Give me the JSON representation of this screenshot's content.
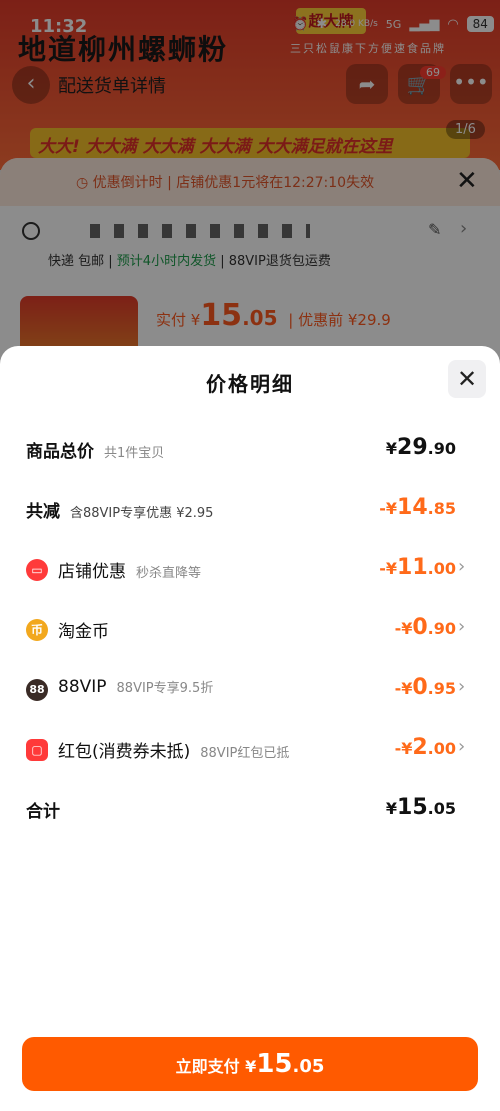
{
  "status_bar": {
    "time": "11:32",
    "network_speed": "28.0 KB/s",
    "network_type": "5G",
    "battery": "84"
  },
  "background_page": {
    "banner_title": "地道柳州螺蛳粉",
    "banner_strip": "大大! 大大满 大大满 大大满 大大满足就在这里",
    "page_counter": "1/6",
    "brand_logo": "超大牌",
    "brand_slogan": "三只松鼠康下方便速食品牌",
    "search_text": "配送货单详情",
    "cart_count": "69",
    "countdown_text": "优惠倒计时 | 店铺优惠1元将在12:27:10失效",
    "shipping_text_1": "快递 包邮",
    "shipping_text_2": "预计4小时内发货",
    "shipping_text_3": "88VIP退货包运费",
    "paid_label": "实付 ¥",
    "paid_int": "15",
    "paid_dec": ".05",
    "before_label": "| 优惠前 ¥29.9"
  },
  "modal": {
    "title": "价格明细",
    "rows": [
      {
        "label": "商品总价",
        "sub": "共1件宝贝",
        "currency": "¥",
        "int": "29",
        "dec": ".90"
      },
      {
        "label": "共减",
        "sub": "含88VIP专享优惠 ¥2.95",
        "currency": "-¥",
        "int": "14",
        "dec": ".85"
      },
      {
        "label": "店铺优惠",
        "sub": "秒杀直降等",
        "currency": "-¥",
        "int": "11",
        "dec": ".00",
        "icon": "store-coupon-icon"
      },
      {
        "label": "淘金币",
        "sub": "",
        "currency": "-¥",
        "int": "0",
        "dec": ".90",
        "icon": "gold-coin-icon",
        "icon_glyph": "币"
      },
      {
        "label": "88VIP",
        "sub": "88VIP专享9.5折",
        "currency": "-¥",
        "int": "0",
        "dec": ".95",
        "icon": "88vip-icon",
        "icon_glyph": "88"
      },
      {
        "label": "红包(消费券未抵)",
        "sub": "88VIP红包已抵",
        "currency": "-¥",
        "int": "2",
        "dec": ".00",
        "icon": "red-packet-icon"
      },
      {
        "label": "合计",
        "sub": "",
        "currency": "¥",
        "int": "15",
        "dec": ".05"
      }
    ]
  },
  "pay_button": {
    "label": "立即支付 ¥",
    "int": "15",
    "dec": ".05"
  },
  "colors": {
    "accent": "#ff5a00",
    "discount": "#ff6a1a",
    "countdown": "#e2562b"
  }
}
